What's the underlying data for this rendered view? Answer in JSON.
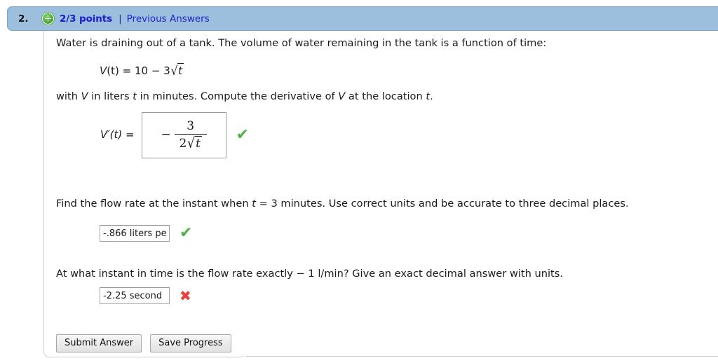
{
  "header": {
    "problem_number": "2.",
    "status_icon": "plus-circle-icon",
    "points": "2/3 points",
    "separator": "|",
    "previous_answers_link": "Previous Answers",
    "band_color": "#9cbfde",
    "points_color": "#1c1ccc",
    "link_color": "#2222cc"
  },
  "question": {
    "intro_text": "Water is draining out of a tank. The volume of water remaining in the tank is a function of time:",
    "formula": {
      "lhs_func": "V",
      "lhs_var": "(t)",
      "equals": "=",
      "constant": "10",
      "minus": "−",
      "coefficient": "3",
      "radical": "√",
      "radicand": "t",
      "plain": "V(t) = 10 − 3√t"
    },
    "units_text_1": "with ",
    "units_var_v": "V",
    "units_text_2": " in liters ",
    "units_var_t": "t",
    "units_text_3": " in minutes. Compute the derivative of ",
    "units_var_v2": "V",
    "units_text_4": " at the location ",
    "units_var_t2": "t",
    "units_text_5": "."
  },
  "derivative_answer": {
    "label": "V′(t)  =",
    "minus_sign": "−",
    "numerator": "3",
    "denominator_coef": "2",
    "denominator_radical": "√",
    "denominator_radicand": "t",
    "plain_value": "− 3/(2√t)",
    "status": "correct",
    "status_mark": "✔",
    "status_color": "#54b14a"
  },
  "part2": {
    "prompt_a": "Find the flow rate at the instant when ",
    "prompt_var": "t",
    "prompt_b": " = 3 minutes. Use correct units and be accurate to three decimal places.",
    "input_value": "-.866 liters pe",
    "input_placeholder": "",
    "status": "correct",
    "status_mark": "✔",
    "status_color": "#54b14a"
  },
  "part3": {
    "prompt": "At what instant in time is the flow rate exactly − 1 l/min? Give an exact decimal answer with units.",
    "input_value": "-2.25 second",
    "input_placeholder": "",
    "status": "incorrect",
    "status_mark": "✖",
    "status_color": "#e8413a"
  },
  "buttons": {
    "submit_label": "Submit Answer",
    "save_label": "Save Progress"
  }
}
